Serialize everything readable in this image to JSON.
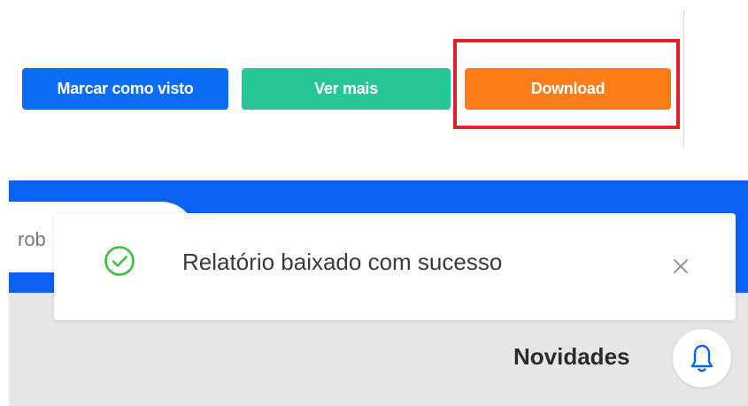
{
  "actions": {
    "mark_seen_label": "Marcar como visto",
    "see_more_label": "Ver mais",
    "download_label": "Download"
  },
  "search": {
    "visible_text": "rob"
  },
  "toast": {
    "message": "Relatório baixado com sucesso",
    "icon": "check-circle-icon",
    "close_icon": "close-icon"
  },
  "header": {
    "news_label": "Novidades",
    "bell_icon": "bell-icon"
  },
  "colors": {
    "primary": "#0a6cf7",
    "success": "#26c695",
    "download": "#fa7d18",
    "highlight": "#e21f26",
    "header_blue": "#0a62f5",
    "toast_check": "#3bbf3b"
  }
}
